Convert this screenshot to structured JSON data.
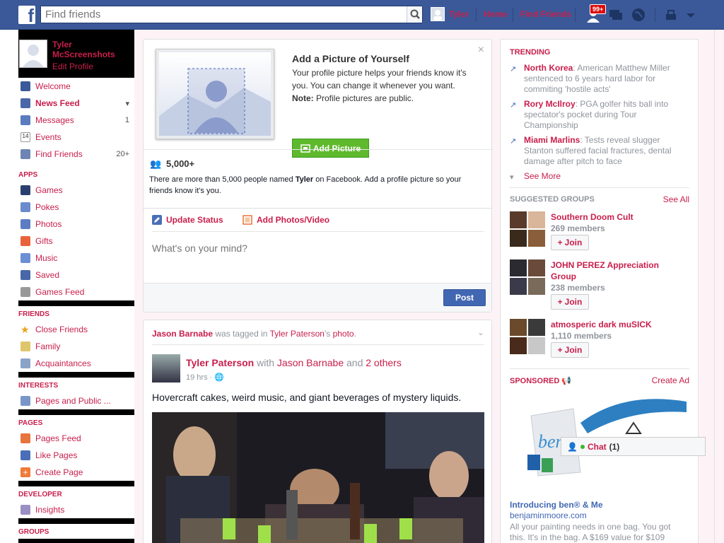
{
  "topbar": {
    "search_placeholder": "Find friends",
    "user": "Tyler",
    "home": "Home",
    "find_friends": "Find Friends",
    "notif_badge": "99+"
  },
  "left": {
    "profile": {
      "name": "Tyler McScreenshots",
      "edit": "Edit Profile"
    },
    "main_items": [
      {
        "label": "Welcome",
        "icon": "facebook-icon",
        "count": ""
      },
      {
        "label": "News Feed",
        "icon": "newsfeed-icon",
        "count": ""
      },
      {
        "label": "Messages",
        "icon": "messages-icon",
        "count": "1"
      },
      {
        "label": "Events",
        "icon": "calendar-icon",
        "count": ""
      },
      {
        "label": "Find Friends",
        "icon": "find-friends-icon",
        "count": "20+"
      }
    ],
    "apps_head": "APPS",
    "apps": [
      {
        "label": "Games",
        "icon": "games-icon"
      },
      {
        "label": "Pokes",
        "icon": "pokes-icon"
      },
      {
        "label": "Photos",
        "icon": "photos-icon"
      },
      {
        "label": "Gifts",
        "icon": "gifts-icon"
      },
      {
        "label": "Music",
        "icon": "music-icon"
      },
      {
        "label": "Saved",
        "icon": "saved-icon"
      },
      {
        "label": "Games Feed",
        "icon": "games-feed-icon"
      }
    ],
    "friends_head": "FRIENDS",
    "friends": [
      {
        "label": "Close Friends",
        "icon": "star-icon"
      },
      {
        "label": "Family",
        "icon": "family-icon"
      },
      {
        "label": "Acquaintances",
        "icon": "acquaintances-icon"
      }
    ],
    "interests_head": "INTERESTS",
    "interests": [
      {
        "label": "Pages and Public ...",
        "icon": "rss-icon"
      }
    ],
    "pages_head": "PAGES",
    "pages": [
      {
        "label": "Pages Feed",
        "icon": "pages-feed-icon"
      },
      {
        "label": "Like Pages",
        "icon": "like-icon"
      },
      {
        "label": "Create Page",
        "icon": "create-page-icon"
      }
    ],
    "developer_head": "DEVELOPER",
    "developer": [
      {
        "label": "Insights",
        "icon": "insights-icon"
      }
    ],
    "groups_head": "GROUPS"
  },
  "addpic": {
    "title": "Add a Picture of Yourself",
    "desc": "Your profile picture helps your friends know it's you. You can change it whenever you want.",
    "note_label": "Note:",
    "note_text": " Profile pictures are public.",
    "button": "Add Picture",
    "count": "5,000+",
    "count_desc_1": "There are more than 5,000 people named ",
    "count_name": "Tyler",
    "count_desc_2": " on Facebook. Add a profile picture so your friends know it's you."
  },
  "status": {
    "update_status": "Update Status",
    "add_photos": "Add Photos/Video",
    "placeholder": "What's on your mind?",
    "post": "Post"
  },
  "feed": {
    "tag_actor": "Jason Barnabe",
    "tag_mid": " was tagged in ",
    "tag_owner": "Tyler Paterson",
    "tag_owner_suffix": "'s ",
    "tag_obj": "photo",
    "tag_end": ".",
    "poster": "Tyler Paterson",
    "with": " with ",
    "with_name": "Jason Barnabe",
    "and": " and ",
    "others": "2 others",
    "time": "19 hrs · ",
    "text": "Hovercraft cakes, weird music, and giant beverages of mystery liquids."
  },
  "right": {
    "trending_head": "TRENDING",
    "trends": [
      {
        "topic": "North Korea",
        "desc": ": American Matthew Miller sentenced to 6 years hard labor for commiting 'hostile acts'"
      },
      {
        "topic": "Rory McIlroy",
        "desc": ": PGA golfer hits ball into spectator's pocket during Tour Championship"
      },
      {
        "topic": "Miami Marlins",
        "desc": ": Tests reveal slugger Stanton suffered facial fractures, dental damage after pitch to face"
      }
    ],
    "see_more": "See More",
    "groups_head": "SUGGESTED GROUPS",
    "see_all": "See All",
    "groups": [
      {
        "name": "Southern Doom Cult",
        "members": "269 members",
        "join": "Join"
      },
      {
        "name": "JOHN PEREZ Appreciation Group",
        "members": "238 members",
        "join": "Join"
      },
      {
        "name": "atmosperic dark muSICK",
        "members": "1,110 members",
        "join": "Join"
      }
    ],
    "sponsored_head": "SPONSORED",
    "create_ad": "Create Ad",
    "ad_title": "Introducing ben® & Me",
    "ad_url": "benjaminmoore.com",
    "ad_desc": "All your painting needs in one bag. You got this. It's in the bag. A $169 value for $109"
  },
  "chat": {
    "label": "Chat",
    "count": "(1)"
  }
}
